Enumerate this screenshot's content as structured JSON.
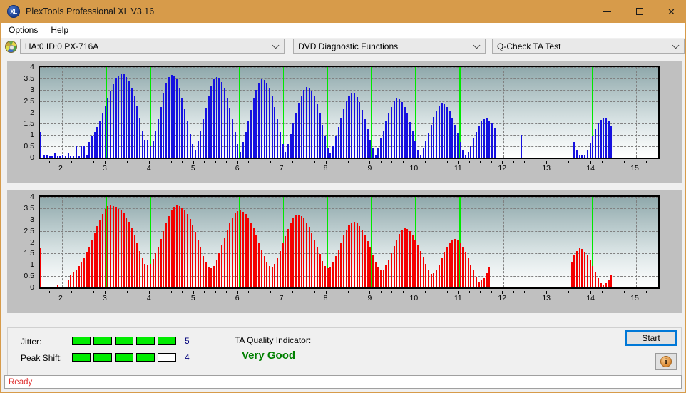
{
  "window": {
    "title": "PlexTools Professional XL V3.16",
    "icon": "xl-app-icon",
    "minimize": "—",
    "maximize": "□",
    "close": "✕"
  },
  "menu": {
    "items": [
      {
        "label": "Options"
      },
      {
        "label": "Help"
      }
    ]
  },
  "toolbar": {
    "drive_icon": "optical-disc-icon",
    "drive_select": {
      "value": "HA:0 ID:0  PX-716A"
    },
    "function_select": {
      "value": "DVD Diagnostic Functions"
    },
    "test_select": {
      "value": "Q-Check TA Test"
    }
  },
  "results": {
    "jitter_label": "Jitter:",
    "jitter_value": "5",
    "jitter_filled": 5,
    "jitter_total": 5,
    "peak_shift_label": "Peak Shift:",
    "peak_shift_value": "4",
    "peak_shift_filled": 4,
    "peak_shift_total": 5,
    "ta_title": "TA Quality Indicator:",
    "ta_value": "Very Good",
    "ta_color": "#008000",
    "start_label": "Start",
    "info_label": "i"
  },
  "statusbar": {
    "text": "Ready"
  },
  "colors": {
    "titlebar": "#d79b4a",
    "jitter_bar": "#00ec00",
    "blue_series": "#1510e0",
    "red_series": "#f40000",
    "marker": "#00e800"
  },
  "chart_data": [
    {
      "type": "bar",
      "id": "ta-test-jitter-chart",
      "title": "",
      "xlabel": "",
      "ylabel": "",
      "series_color": "#1510e0",
      "xlim": [
        1.5,
        15.5
      ],
      "ylim": [
        0,
        4
      ],
      "yticks": [
        0,
        0.5,
        1,
        1.5,
        2,
        2.5,
        3,
        3.5,
        4
      ],
      "xticks": [
        2,
        3,
        4,
        5,
        6,
        7,
        8,
        9,
        10,
        11,
        12,
        13,
        14,
        15
      ],
      "grid": true,
      "markers": [
        3,
        4,
        5,
        6,
        7,
        8,
        9,
        10,
        11,
        14
      ],
      "x": [
        1.6,
        1.66,
        1.72,
        1.78,
        1.84,
        1.9,
        1.96,
        2.02,
        2.08,
        2.14,
        2.2,
        2.26,
        2.32,
        2.38,
        2.44,
        2.5,
        2.56,
        2.62,
        2.68,
        2.74,
        2.8,
        2.86,
        2.92,
        2.98,
        3.04,
        3.1,
        3.16,
        3.22,
        3.28,
        3.34,
        3.4,
        3.46,
        3.52,
        3.58,
        3.64,
        3.7,
        3.76,
        3.82,
        3.88,
        3.94,
        4.0,
        4.06,
        4.12,
        4.18,
        4.24,
        4.3,
        4.36,
        4.42,
        4.48,
        4.54,
        4.6,
        4.66,
        4.72,
        4.78,
        4.84,
        4.9,
        4.96,
        5.02,
        5.08,
        5.14,
        5.2,
        5.26,
        5.32,
        5.38,
        5.44,
        5.5,
        5.56,
        5.62,
        5.68,
        5.74,
        5.8,
        5.86,
        5.92,
        5.98,
        6.04,
        6.1,
        6.16,
        6.22,
        6.28,
        6.34,
        6.4,
        6.46,
        6.52,
        6.58,
        6.64,
        6.7,
        6.76,
        6.82,
        6.88,
        6.94,
        7.0,
        7.06,
        7.12,
        7.18,
        7.24,
        7.3,
        7.36,
        7.42,
        7.48,
        7.54,
        7.6,
        7.66,
        7.72,
        7.78,
        7.84,
        7.9,
        7.96,
        8.02,
        8.08,
        8.14,
        8.2,
        8.26,
        8.32,
        8.38,
        8.44,
        8.5,
        8.56,
        8.62,
        8.68,
        8.74,
        8.8,
        8.86,
        8.92,
        8.98,
        9.04,
        9.1,
        9.16,
        9.22,
        9.28,
        9.34,
        9.4,
        9.46,
        9.52,
        9.58,
        9.64,
        9.7,
        9.76,
        9.82,
        9.88,
        9.94,
        10.0,
        10.06,
        10.12,
        10.18,
        10.24,
        10.3,
        10.36,
        10.42,
        10.48,
        10.54,
        10.6,
        10.66,
        10.72,
        10.78,
        10.84,
        10.9,
        10.96,
        11.02,
        11.08,
        11.14,
        11.2,
        11.26,
        11.32,
        11.38,
        11.44,
        11.5,
        11.56,
        11.62,
        11.68,
        11.74,
        11.8,
        12.4,
        13.6,
        13.66,
        13.72,
        13.78,
        13.84,
        13.9,
        13.96,
        14.02,
        14.08,
        14.14,
        14.2,
        14.26,
        14.32,
        14.38,
        14.44
      ],
      "values": [
        0.1,
        0.08,
        0.06,
        0.05,
        0.2,
        0.05,
        0.06,
        0.08,
        0.06,
        0.22,
        0.05,
        0.06,
        0.5,
        0.06,
        0.55,
        0.5,
        0.08,
        0.7,
        0.95,
        1.15,
        1.35,
        1.6,
        1.95,
        2.3,
        2.65,
        2.95,
        3.25,
        3.5,
        3.62,
        3.7,
        3.68,
        3.55,
        3.4,
        3.1,
        2.75,
        2.3,
        1.75,
        1.2,
        0.8,
        0.8,
        0.55,
        0.75,
        1.2,
        1.7,
        2.25,
        2.85,
        3.3,
        3.55,
        3.65,
        3.62,
        3.45,
        3.1,
        2.65,
        2.15,
        1.6,
        1.05,
        0.6,
        0.3,
        0.75,
        1.2,
        1.7,
        2.2,
        2.75,
        3.15,
        3.45,
        3.55,
        3.5,
        3.35,
        3.05,
        2.65,
        2.2,
        1.7,
        1.15,
        0.6,
        0.25,
        0.7,
        1.15,
        1.6,
        2.1,
        2.6,
        3.0,
        3.3,
        3.45,
        3.42,
        3.3,
        3.05,
        2.7,
        2.25,
        1.7,
        1.15,
        0.6,
        0.25,
        0.6,
        1.05,
        1.5,
        1.95,
        2.4,
        2.75,
        3.0,
        3.12,
        3.08,
        2.95,
        2.7,
        2.35,
        1.95,
        1.45,
        0.95,
        0.45,
        0.18,
        0.55,
        0.95,
        1.35,
        1.75,
        2.15,
        2.5,
        2.72,
        2.85,
        2.82,
        2.68,
        2.45,
        2.1,
        1.7,
        1.25,
        0.8,
        0.4,
        0.12,
        0.45,
        0.85,
        1.2,
        1.6,
        1.95,
        2.25,
        2.48,
        2.6,
        2.58,
        2.45,
        2.25,
        1.95,
        1.58,
        1.18,
        0.75,
        0.35,
        0.12,
        0.4,
        0.75,
        1.1,
        1.45,
        1.8,
        2.08,
        2.28,
        2.38,
        2.36,
        2.25,
        2.05,
        1.78,
        1.45,
        1.08,
        0.68,
        0.3,
        0.1,
        0.25,
        0.55,
        0.85,
        1.15,
        1.42,
        1.6,
        1.7,
        1.72,
        1.65,
        1.5,
        1.28,
        1.0,
        0.68,
        0.35,
        0.12,
        0.1,
        0.12,
        0.35,
        0.65,
        0.95,
        1.25,
        1.5,
        1.68,
        1.78,
        1.75,
        1.62,
        1.42,
        1.15,
        0.82,
        0.48,
        0.18
      ]
    },
    {
      "type": "bar",
      "id": "ta-test-peak-shift-chart",
      "title": "",
      "xlabel": "",
      "ylabel": "",
      "series_color": "#f40000",
      "xlim": [
        1.5,
        15.5
      ],
      "ylim": [
        0,
        4
      ],
      "yticks": [
        0,
        0.5,
        1,
        1.5,
        2,
        2.5,
        3,
        3.5,
        4
      ],
      "xticks": [
        2,
        3,
        4,
        5,
        6,
        7,
        8,
        9,
        10,
        11,
        12,
        13,
        14,
        15
      ],
      "grid": true,
      "markers": [
        3,
        4,
        5,
        6,
        7,
        8,
        9,
        10,
        11,
        14
      ],
      "x": [
        1.9,
        2.14,
        2.2,
        2.26,
        2.32,
        2.38,
        2.44,
        2.5,
        2.56,
        2.62,
        2.68,
        2.74,
        2.8,
        2.86,
        2.92,
        2.98,
        3.04,
        3.1,
        3.16,
        3.22,
        3.28,
        3.34,
        3.4,
        3.46,
        3.52,
        3.58,
        3.64,
        3.7,
        3.76,
        3.82,
        3.88,
        3.94,
        4.0,
        4.06,
        4.12,
        4.18,
        4.24,
        4.3,
        4.36,
        4.42,
        4.48,
        4.54,
        4.6,
        4.66,
        4.72,
        4.78,
        4.84,
        4.9,
        4.96,
        5.02,
        5.08,
        5.14,
        5.2,
        5.26,
        5.32,
        5.38,
        5.44,
        5.5,
        5.56,
        5.62,
        5.68,
        5.74,
        5.8,
        5.86,
        5.92,
        5.98,
        6.04,
        6.1,
        6.16,
        6.22,
        6.28,
        6.34,
        6.4,
        6.46,
        6.52,
        6.58,
        6.64,
        6.7,
        6.76,
        6.82,
        6.88,
        6.94,
        7.0,
        7.06,
        7.12,
        7.18,
        7.24,
        7.3,
        7.36,
        7.42,
        7.48,
        7.54,
        7.6,
        7.66,
        7.72,
        7.78,
        7.84,
        7.9,
        7.96,
        8.02,
        8.08,
        8.14,
        8.2,
        8.26,
        8.32,
        8.38,
        8.44,
        8.5,
        8.56,
        8.62,
        8.68,
        8.74,
        8.8,
        8.86,
        8.92,
        8.98,
        9.04,
        9.1,
        9.16,
        9.22,
        9.28,
        9.34,
        9.4,
        9.46,
        9.52,
        9.58,
        9.64,
        9.7,
        9.76,
        9.82,
        9.88,
        9.94,
        10.0,
        10.06,
        10.12,
        10.18,
        10.24,
        10.3,
        10.36,
        10.42,
        10.48,
        10.54,
        10.6,
        10.66,
        10.72,
        10.78,
        10.84,
        10.9,
        10.96,
        11.02,
        11.08,
        11.14,
        11.2,
        11.26,
        11.32,
        11.38,
        11.44,
        11.5,
        11.56,
        11.62,
        11.68,
        13.54,
        13.6,
        13.66,
        13.72,
        13.78,
        13.84,
        13.9,
        13.96,
        14.02,
        14.08,
        14.14,
        14.2,
        14.26,
        14.32,
        14.38,
        14.44
      ],
      "values": [
        0.12,
        0.32,
        0.55,
        0.7,
        0.8,
        0.95,
        1.1,
        1.3,
        1.55,
        1.8,
        2.1,
        2.4,
        2.7,
        3.0,
        3.25,
        3.45,
        3.58,
        3.62,
        3.6,
        3.55,
        3.48,
        3.4,
        3.28,
        3.1,
        2.9,
        2.62,
        2.3,
        1.95,
        1.6,
        1.3,
        1.05,
        1.0,
        1.05,
        1.25,
        1.5,
        1.8,
        2.15,
        2.5,
        2.85,
        3.15,
        3.4,
        3.55,
        3.62,
        3.6,
        3.52,
        3.42,
        3.25,
        3.02,
        2.75,
        2.45,
        2.1,
        1.75,
        1.4,
        1.1,
        0.9,
        0.85,
        0.95,
        1.2,
        1.5,
        1.85,
        2.2,
        2.55,
        2.85,
        3.1,
        3.28,
        3.38,
        3.4,
        3.35,
        3.25,
        3.08,
        2.88,
        2.62,
        2.32,
        2.0,
        1.68,
        1.38,
        1.12,
        0.95,
        0.92,
        1.05,
        1.3,
        1.6,
        1.95,
        2.28,
        2.58,
        2.85,
        3.05,
        3.18,
        3.2,
        3.15,
        3.05,
        2.88,
        2.68,
        2.42,
        2.12,
        1.8,
        1.48,
        1.18,
        0.95,
        0.85,
        0.9,
        1.1,
        1.38,
        1.68,
        2.0,
        2.3,
        2.55,
        2.75,
        2.88,
        2.9,
        2.85,
        2.72,
        2.55,
        2.32,
        2.05,
        1.75,
        1.45,
        1.15,
        0.9,
        0.75,
        0.8,
        0.98,
        1.22,
        1.52,
        1.82,
        2.1,
        2.35,
        2.52,
        2.6,
        2.58,
        2.48,
        2.32,
        2.12,
        1.88,
        1.6,
        1.32,
        1.05,
        0.8,
        0.6,
        0.62,
        0.8,
        1.02,
        1.28,
        1.55,
        1.8,
        2.0,
        2.12,
        2.15,
        2.08,
        1.95,
        1.78,
        1.55,
        1.3,
        1.02,
        0.75,
        0.48,
        0.25,
        0.3,
        0.42,
        0.62,
        0.88,
        1.15,
        1.42,
        1.62,
        1.72,
        1.7,
        1.58,
        1.42,
        1.2,
        0.95,
        0.68,
        0.42,
        0.18,
        0.08,
        0.18,
        0.35,
        0.58,
        0.85,
        1.12,
        1.38,
        1.58,
        1.7,
        1.72,
        1.65,
        1.5,
        1.3,
        1.05,
        0.78,
        0.5
      ]
    }
  ]
}
